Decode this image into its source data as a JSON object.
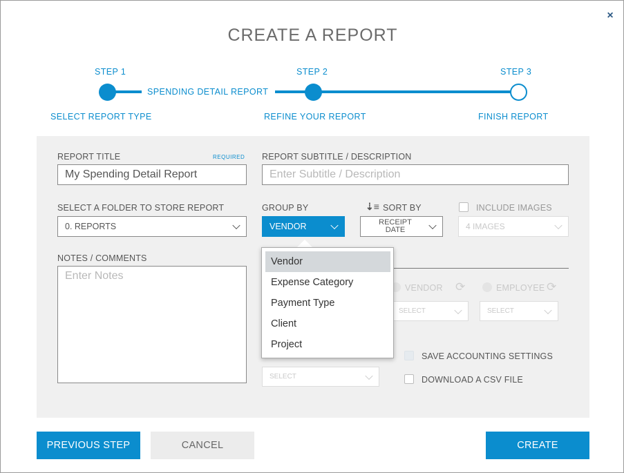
{
  "modal": {
    "title": "CREATE A REPORT",
    "close_symbol": "×"
  },
  "stepper": {
    "steps": [
      {
        "number": "STEP 1",
        "caption": "SELECT REPORT TYPE"
      },
      {
        "number": "STEP 2",
        "caption": "REFINE YOUR REPORT"
      },
      {
        "number": "STEP 3",
        "caption": "FINISH REPORT"
      }
    ],
    "selected_type": "SPENDING DETAIL REPORT",
    "accent_color": "#0b8dce"
  },
  "form": {
    "report_title": {
      "label": "REPORT TITLE",
      "required": "REQUIRED",
      "value": "My Spending Detail Report"
    },
    "subtitle": {
      "label": "REPORT SUBTITLE / DESCRIPTION",
      "placeholder": "Enter Subtitle / Description"
    },
    "folder": {
      "label": "SELECT A FOLDER TO STORE REPORT",
      "value": "0. REPORTS"
    },
    "group_by": {
      "label": "GROUP BY",
      "value": "VENDOR"
    },
    "sort_by": {
      "label": "SORT BY",
      "value_line1": "RECEIPT",
      "value_line2": "DATE",
      "icon": "sort-descending-icon"
    },
    "include_images": {
      "label": "INCLUDE IMAGES",
      "value": "4 IMAGES"
    },
    "notes": {
      "label": "NOTES / COMMENTS",
      "placeholder": "Enter Notes"
    },
    "accounting": {
      "vendor_label": "VENDOR",
      "employee_label": "EMPLOYEE",
      "vendor_select": "SELECT",
      "employee_select": "SELECT",
      "left_select": "SELECT",
      "save_settings_label": "SAVE ACCOUNTING SETTINGS",
      "download_csv_label": "DOWNLOAD A CSV FILE"
    }
  },
  "group_by_dropdown": {
    "options": [
      "Vendor",
      "Expense Category",
      "Payment Type",
      "Client",
      "Project"
    ],
    "selected": "Vendor"
  },
  "buttons": {
    "previous": "PREVIOUS STEP",
    "cancel": "CANCEL",
    "create": "CREATE"
  }
}
